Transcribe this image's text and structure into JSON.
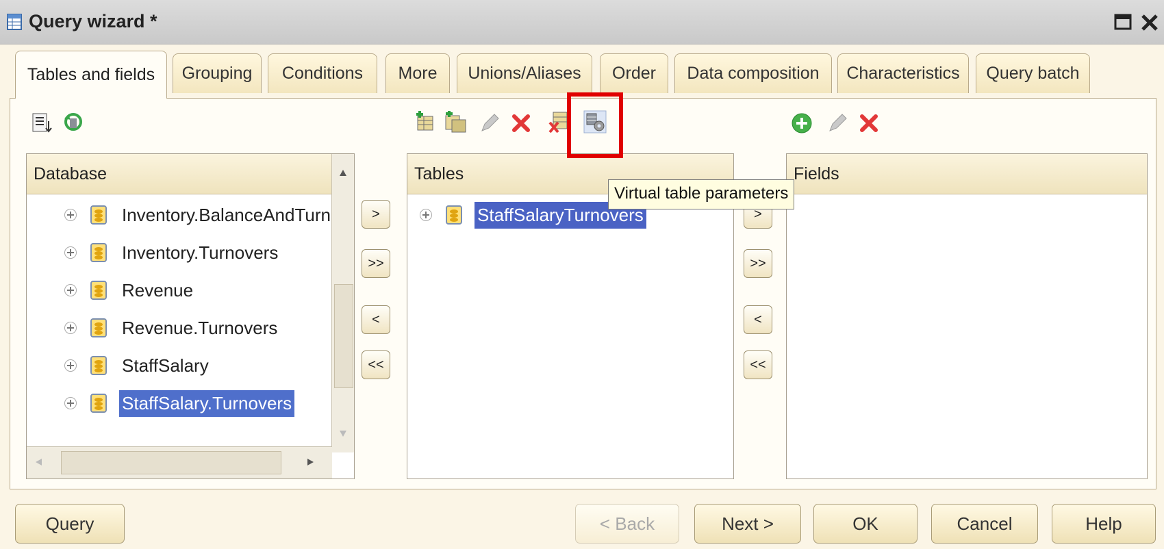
{
  "window": {
    "title": "Query wizard *",
    "icons": {
      "app": "table-icon",
      "maximize": "maximize-icon",
      "close": "close-icon"
    }
  },
  "tabs": [
    {
      "label": "Tables and fields",
      "active": true
    },
    {
      "label": "Grouping"
    },
    {
      "label": "Conditions"
    },
    {
      "label": "More"
    },
    {
      "label": "Unions/Aliases"
    },
    {
      "label": "Order"
    },
    {
      "label": "Data composition"
    },
    {
      "label": "Characteristics"
    },
    {
      "label": "Query batch"
    }
  ],
  "database_panel": {
    "header": "Database",
    "items": [
      {
        "label": "Inventory.BalanceAndTurno"
      },
      {
        "label": "Inventory.Turnovers"
      },
      {
        "label": "Revenue"
      },
      {
        "label": "Revenue.Turnovers"
      },
      {
        "label": "StaffSalary"
      },
      {
        "label": "StaffSalary.Turnovers",
        "selected": true
      }
    ]
  },
  "tables_panel": {
    "header": "Tables",
    "items": [
      {
        "label": "StaffSalaryTurnovers",
        "selected": true
      }
    ]
  },
  "fields_panel": {
    "header": "Fields",
    "items": []
  },
  "move_buttons": {
    "add": ">",
    "add_all": ">>",
    "remove": "<",
    "remove_all": "<<"
  },
  "tooltip": "Virtual table parameters",
  "bottom_buttons": {
    "query": "Query",
    "back": "< Back",
    "next": "Next >",
    "ok": "OK",
    "cancel": "Cancel",
    "help": "Help"
  },
  "colors": {
    "selection": "#4f6fcb",
    "highlight": "#e00000",
    "accent_bg": "#fbf5e6"
  }
}
